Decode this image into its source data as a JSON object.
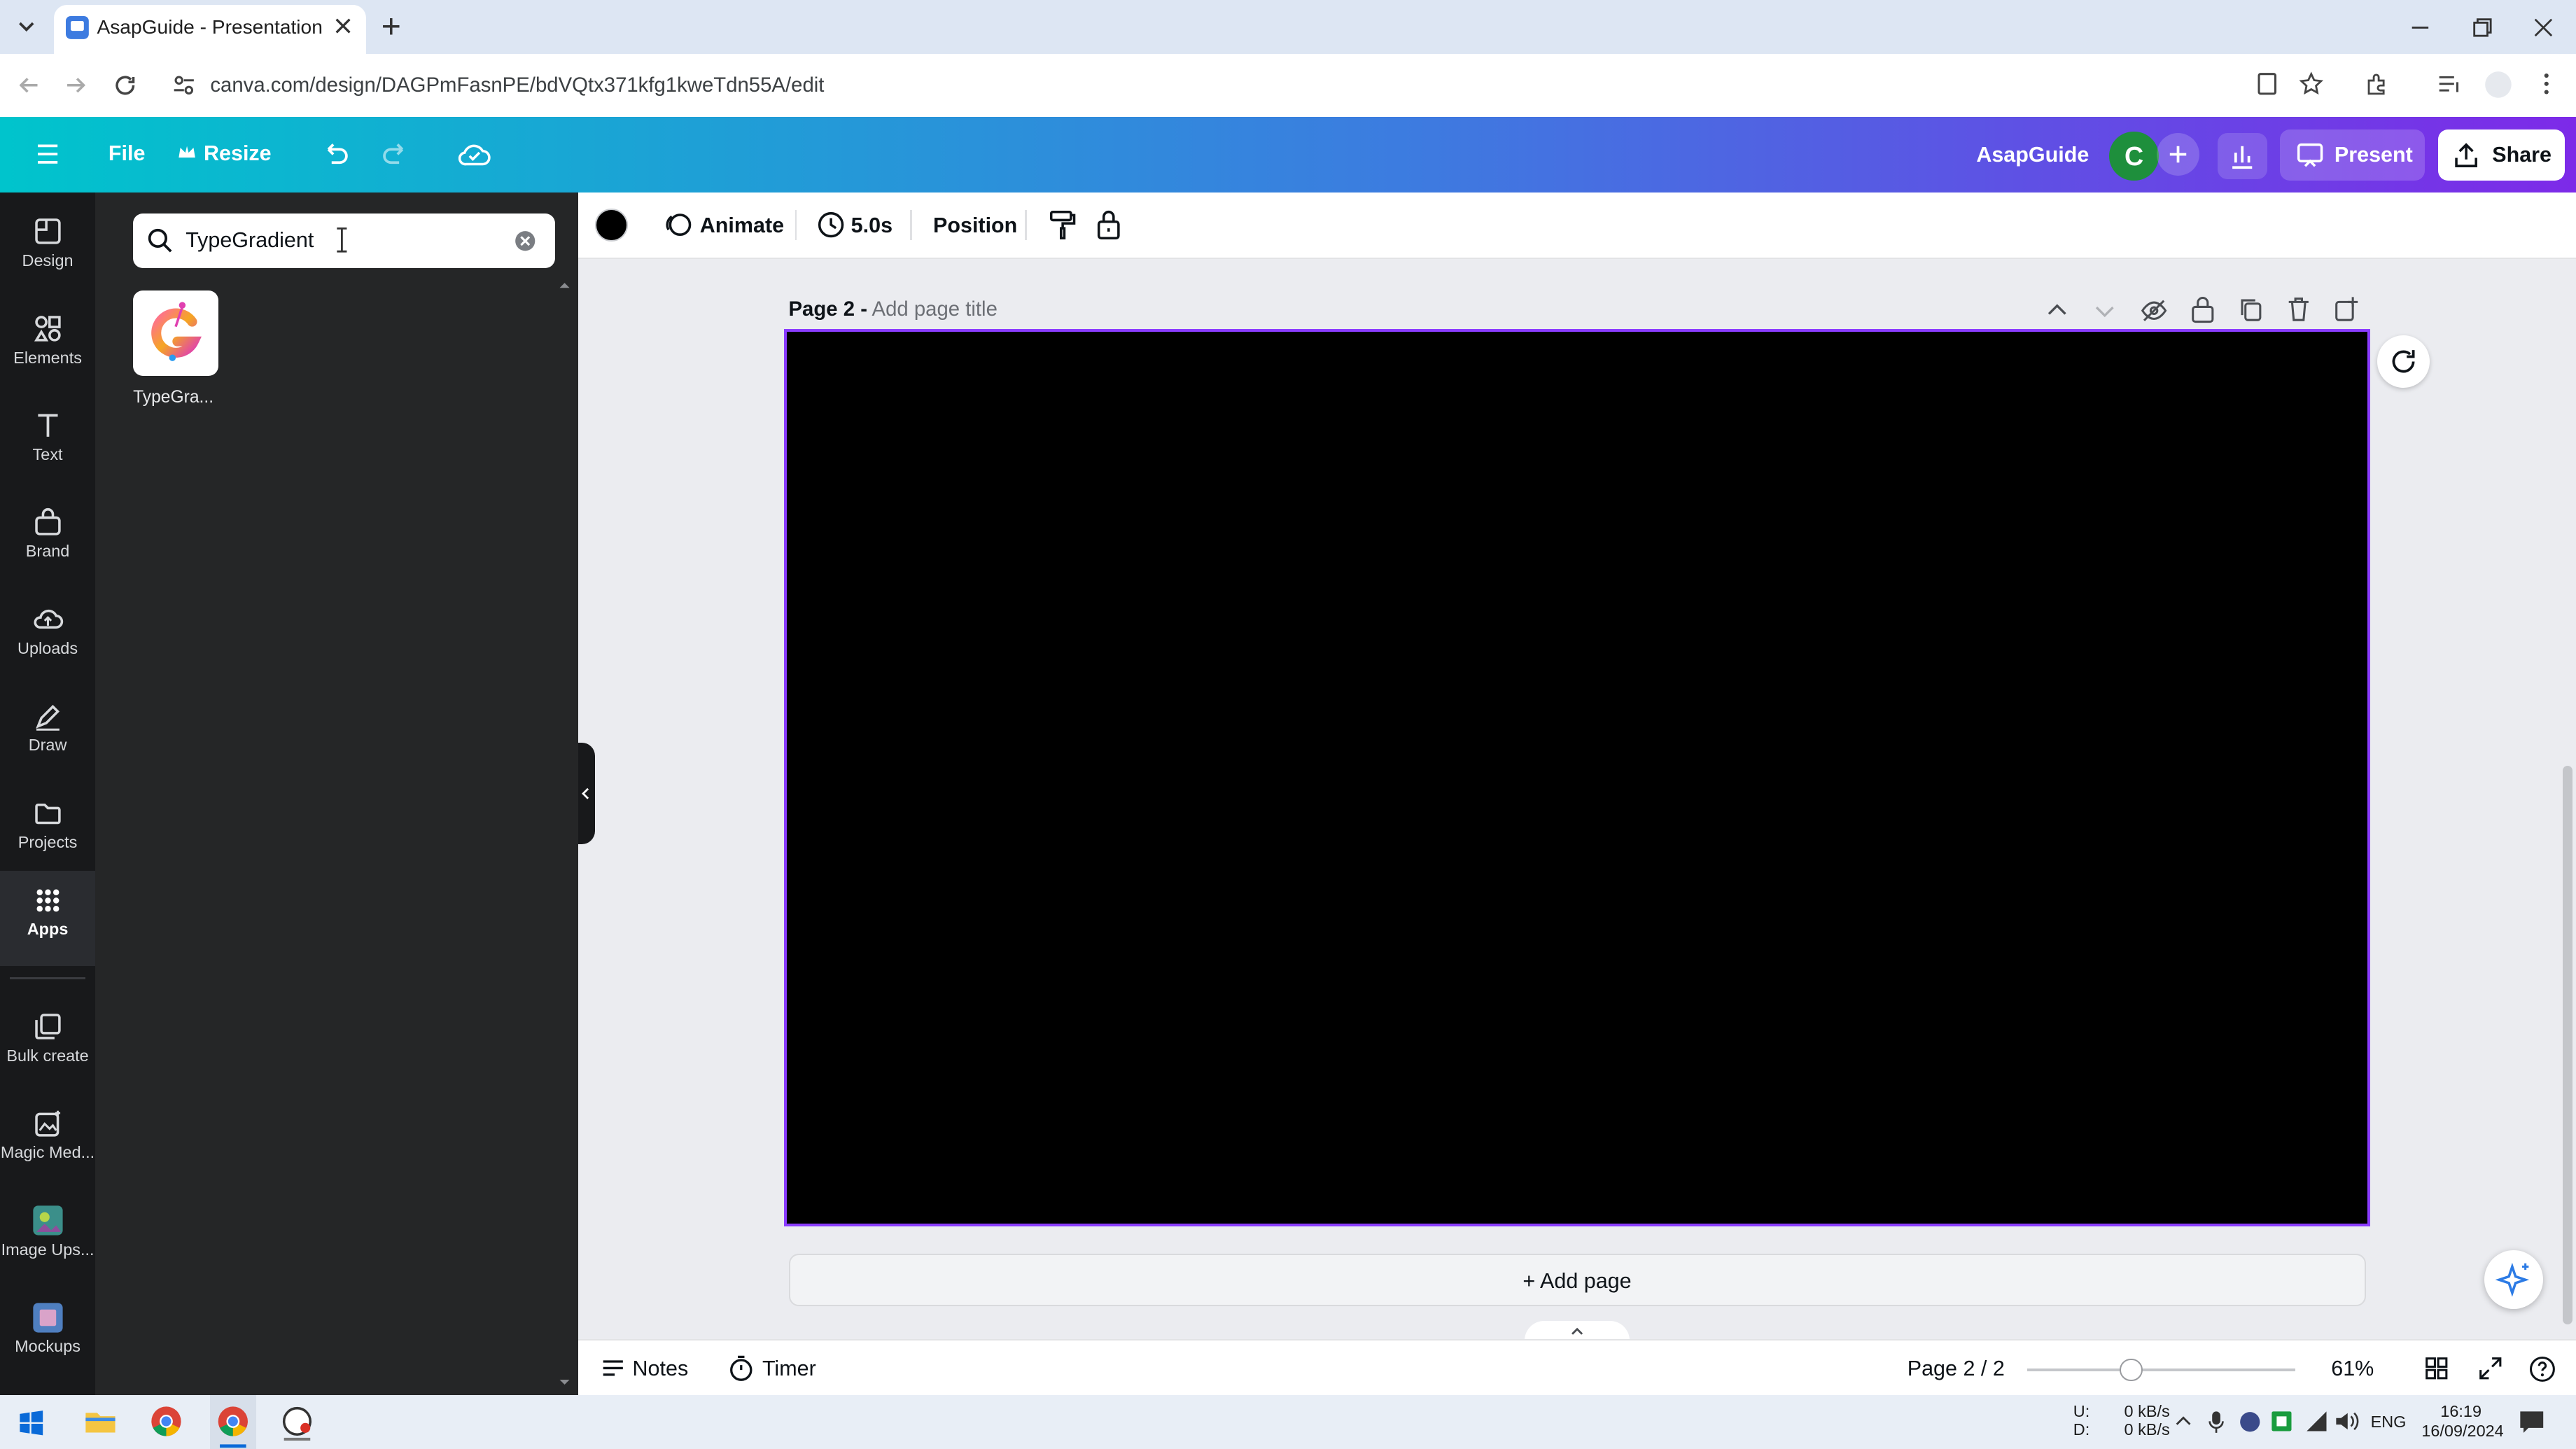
{
  "browser": {
    "tab_title": "AsapGuide - Presentation",
    "url": "canva.com/design/DAGPmFasnPE/bdVQtx371kfg1kweTdn55A/edit"
  },
  "header": {
    "file": "File",
    "resize": "Resize",
    "team_name": "AsapGuide",
    "avatar_letter": "C",
    "present": "Present",
    "share": "Share"
  },
  "rail": [
    {
      "label": "Design",
      "icon": "design-icon"
    },
    {
      "label": "Elements",
      "icon": "elements-icon"
    },
    {
      "label": "Text",
      "icon": "text-icon"
    },
    {
      "label": "Brand",
      "icon": "brand-icon"
    },
    {
      "label": "Uploads",
      "icon": "uploads-icon"
    },
    {
      "label": "Draw",
      "icon": "draw-icon"
    },
    {
      "label": "Projects",
      "icon": "projects-icon"
    },
    {
      "label": "Apps",
      "icon": "apps-icon"
    },
    {
      "label": "Bulk create",
      "icon": "bulk-create-icon"
    },
    {
      "label": "Magic Med...",
      "icon": "magic-media-icon"
    },
    {
      "label": "Image Ups...",
      "icon": "image-upscaler-icon"
    },
    {
      "label": "Mockups",
      "icon": "mockups-icon"
    }
  ],
  "panel": {
    "search_value": "TypeGradient",
    "result_label": "TypeGra..."
  },
  "toolbar": {
    "animate": "Animate",
    "duration": "5.0s",
    "position": "Position"
  },
  "page": {
    "title_prefix": "Page 2 -",
    "title_placeholder": "Add page title",
    "add_page": "+ Add page"
  },
  "bottom": {
    "notes": "Notes",
    "timer": "Timer",
    "page_indicator": "Page 2 / 2",
    "zoom": "61%",
    "zoom_fraction": 0.61
  },
  "taskbar": {
    "net_up_label": "U:",
    "net_down_label": "D:",
    "net_up": "0 kB/s",
    "net_down": "0 kB/s",
    "lang": "ENG",
    "time": "16:19",
    "date": "16/09/2024"
  },
  "colors": {
    "brand_start": "#00c4cc",
    "brand_end": "#7d2ae8",
    "selection": "#8b3dff"
  }
}
